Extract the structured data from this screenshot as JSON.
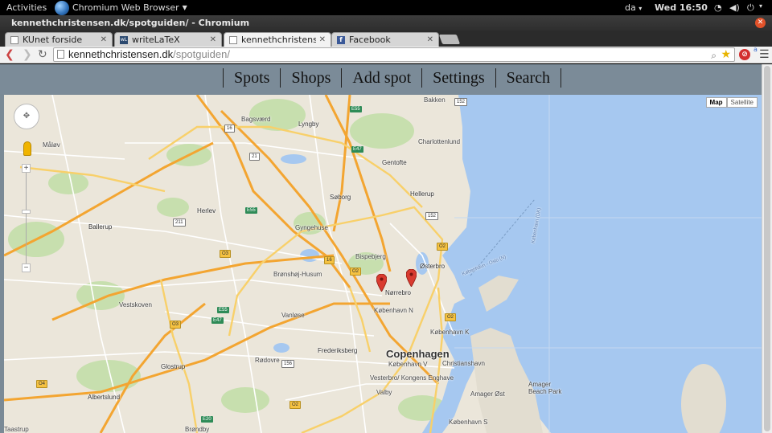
{
  "topbar": {
    "activities": "Activities",
    "app_name": "Chromium Web Browser",
    "language": "da",
    "clock": "Wed 16:50"
  },
  "window": {
    "title": "kennethchristensen.dk/spotguiden/ - Chromium"
  },
  "tabs": [
    {
      "label": "KUnet forside"
    },
    {
      "label": "writeLaTeX"
    },
    {
      "label": "kennethchristensen.dk"
    },
    {
      "label": "Facebook"
    }
  ],
  "omnibox": {
    "host": "kennethchristensen.dk",
    "path": "/spotguiden/"
  },
  "site_nav": {
    "items": [
      "Spots",
      "Shops",
      "Add spot",
      "Settings",
      "Search"
    ]
  },
  "map": {
    "type_buttons": {
      "map": "Map",
      "satellite": "Satellite"
    },
    "labels": {
      "copenhagen": "Copenhagen",
      "norrebro": "Nørrebro",
      "frederiksberg": "Frederiksberg",
      "gentofte": "Gentofte",
      "hellerup": "Hellerup",
      "soborg": "Søborg",
      "herlev": "Herlev",
      "ballerup": "Ballerup",
      "lyngby": "Lyngby",
      "glostrup": "Glostrup",
      "albertslund": "Albertslund",
      "osterbro": "Østerbro",
      "bispebjerg": "Bispebjerg",
      "bronshoj": "Brønshøj-Husum",
      "vanlose": "Vanløse",
      "valby": "Valby",
      "vesterbro": "Vesterbro/\nKongens\nEnghave",
      "kobenhavn_n": "København N",
      "kobenhavn_k": "København K",
      "kobenhavn_v": "København V",
      "kobenhavn_s": "København S",
      "christianshavn": "Christianshavn",
      "amager_ost": "Amager Øst",
      "amager_strandpark": "Amager\nBeach Park",
      "charlottenlund": "Charlottenlund",
      "bakken": "Bakken",
      "bagsvaerd": "Bagsværd",
      "malov": "Måløv",
      "rodovre": "Rødovre",
      "vestskoven": "Vestskoven",
      "brondby": "Brøndby",
      "gyngehuse": "Gyngehuse",
      "ferry_route_1": "København - Oslo (N)",
      "ferry_route_2": "København (DK)",
      "ferry_route_3": "Københavns - Oslo (N)",
      "taastrup": "Taastrup"
    },
    "road_shields": {
      "e55": "E55",
      "e47": "E47",
      "e20": "E20",
      "r16": "16",
      "r21": "21",
      "r152": "152",
      "r156": "156",
      "r211": "211",
      "o2": "O2",
      "o3": "O3",
      "o4": "O4"
    }
  },
  "colors": {
    "site_nav_bg": "#7b8b98",
    "water": "#a6c8f0",
    "park": "#c4dca8",
    "marker": "#d93b30"
  }
}
